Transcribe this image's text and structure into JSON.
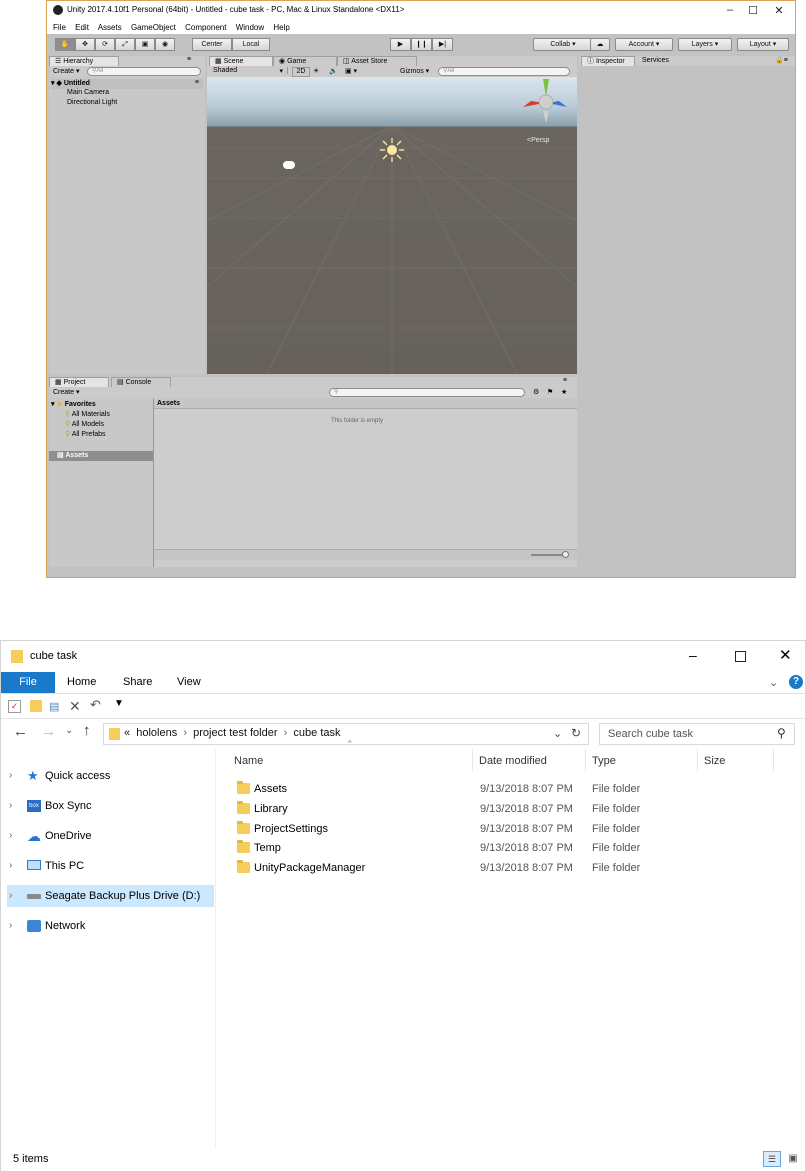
{
  "unity": {
    "title": "Unity 2017.4.10f1 Personal (64bit) - Untitled - cube task - PC, Mac & Linux Standalone <DX11>",
    "menu": [
      "File",
      "Edit",
      "Assets",
      "GameObject",
      "Component",
      "Window",
      "Help"
    ],
    "toolbar": {
      "center_label": "Center",
      "local_label": "Local",
      "collab_label": "Collab",
      "account_label": "Account",
      "layers_label": "Layers",
      "layout_label": "Layout"
    },
    "hierarchy": {
      "tab": "Hierarchy",
      "create": "Create",
      "search_placeholder": "All",
      "scene_name": "Untitled",
      "items": [
        "Main Camera",
        "Directional Light"
      ]
    },
    "scene": {
      "tabs": [
        "Scene",
        "Game",
        "Asset Store"
      ],
      "shading": "Shaded",
      "mode_2d": "2D",
      "gizmos": "Gizmos",
      "search_placeholder": "All",
      "persp": "<Persp"
    },
    "inspector": {
      "tabs": [
        "Inspector",
        "Services"
      ]
    },
    "project": {
      "tabs": [
        "Project",
        "Console"
      ],
      "create": "Create",
      "favorites_label": "Favorites",
      "favorites": [
        "All Materials",
        "All Models",
        "All Prefabs"
      ],
      "assets_tree": "Assets",
      "assets_header": "Assets",
      "empty_message": "This folder is empty"
    }
  },
  "explorer": {
    "title": "cube task",
    "ribbon_tabs": [
      "File",
      "Home",
      "Share",
      "View"
    ],
    "path": [
      "hololens",
      "project test folder",
      "cube task"
    ],
    "path_prefix": "«",
    "search_placeholder": "Search cube task",
    "sidebar": [
      {
        "label": "Quick access",
        "icon": "star-icon"
      },
      {
        "label": "Box Sync",
        "icon": "box-icon"
      },
      {
        "label": "OneDrive",
        "icon": "cloud-icon"
      },
      {
        "label": "This PC",
        "icon": "computer-icon"
      },
      {
        "label": "Seagate Backup Plus Drive (D:)",
        "icon": "drive-icon",
        "selected": true
      },
      {
        "label": "Network",
        "icon": "network-icon"
      }
    ],
    "columns": [
      "Name",
      "Date modified",
      "Type",
      "Size"
    ],
    "files": [
      {
        "name": "Assets",
        "date": "9/13/2018 8:07 PM",
        "type": "File folder"
      },
      {
        "name": "Library",
        "date": "9/13/2018 8:07 PM",
        "type": "File folder"
      },
      {
        "name": "ProjectSettings",
        "date": "9/13/2018 8:07 PM",
        "type": "File folder"
      },
      {
        "name": "Temp",
        "date": "9/13/2018 8:07 PM",
        "type": "File folder"
      },
      {
        "name": "UnityPackageManager",
        "date": "9/13/2018 8:07 PM",
        "type": "File folder"
      }
    ],
    "status": "5 items"
  },
  "colors": {
    "explorer_accent": "#1979ca",
    "selection": "#cce8ff",
    "folder": "#f4cd5a",
    "unity_chrome": "#c2c2c2",
    "scene_ground": "#66615b"
  }
}
